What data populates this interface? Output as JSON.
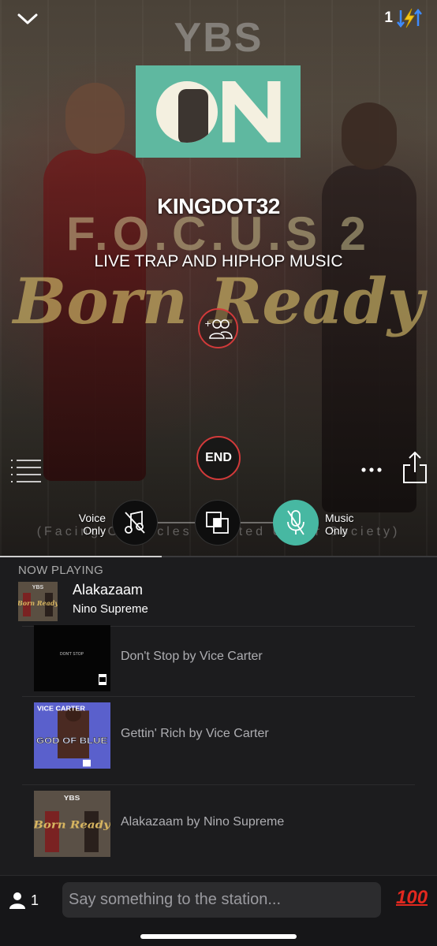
{
  "status": {
    "badge_count": "1"
  },
  "cover": {
    "ybs": "YBS",
    "focus": "F.O.C.U.S 2",
    "born_ready": "Born Ready",
    "subtitle": "(Facing Obstacles Created Under Society)"
  },
  "station": {
    "name": "KINGDOT32",
    "description": "LIVE TRAP AND HIPHOP MUSIC",
    "end_label": "END"
  },
  "modes": {
    "voice_label_1": "Voice",
    "voice_label_2": "Only",
    "music_label_1": "Music",
    "music_label_2": "Only",
    "active": "music-only"
  },
  "now_playing": {
    "label": "NOW PLAYING",
    "title": "Alakazaam",
    "artist": "Nino Supreme",
    "progress": 0.37
  },
  "queue": [
    {
      "label": "Don't Stop by Vice Carter",
      "art_text": "DON'T STOP"
    },
    {
      "label": "Gettin' Rich by Vice Carter",
      "art_text": "GOD OF BLUE",
      "art_text_2": "VICE CARTER"
    },
    {
      "label": "Alakazaam by Nino Supreme",
      "art_text": "Born Ready",
      "art_text_2": "YBS"
    }
  ],
  "bottom": {
    "listener_count": "1",
    "chat_placeholder": "Say something to the station...",
    "emoji": "100"
  },
  "colors": {
    "accent_teal": "#47b8a2",
    "end_red": "#d23a3a",
    "hundred_red": "#e2281f",
    "bolt_yellow": "#f5c518",
    "arrows_blue": "#3d8bff"
  }
}
